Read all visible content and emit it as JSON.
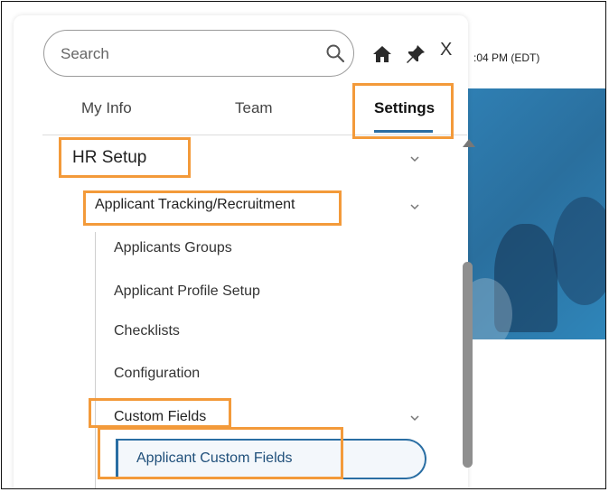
{
  "background": {
    "time_text": ":04 PM (EDT)"
  },
  "search": {
    "placeholder": "Search"
  },
  "header_icons": [
    "home-icon",
    "pin-icon",
    "close-icon"
  ],
  "close_label": "X",
  "tabs": [
    {
      "label": "My Info"
    },
    {
      "label": "Team"
    },
    {
      "label": "Settings",
      "active": true
    }
  ],
  "tree": {
    "hr_setup": "HR Setup",
    "applicant_tracking": "Applicant Tracking/Recruitment",
    "items": [
      "Applicants Groups",
      "Applicant Profile Setup",
      "Checklists",
      "Configuration"
    ],
    "custom_fields": "Custom Fields",
    "applicant_custom_fields": "Applicant Custom Fields"
  },
  "colors": {
    "accent": "#2a6ea3",
    "highlight": "#f39a3a",
    "banner": "#2f7fb3"
  }
}
